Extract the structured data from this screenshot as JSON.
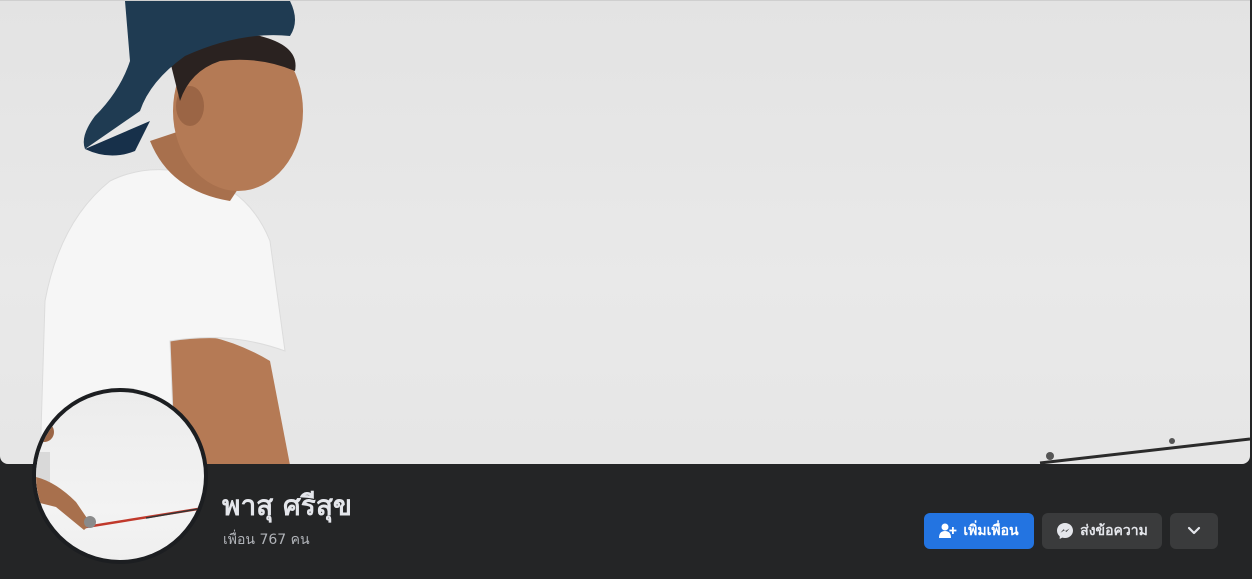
{
  "profile": {
    "name": "พาสุ ศรีสุข",
    "friends_text": "เพื่อน 767 คน"
  },
  "actions": {
    "add_friend_label": "เพิ่มเพื่อน",
    "message_label": "ส่งข้อความ",
    "more_icon": "chevron-down-icon"
  },
  "colors": {
    "background": "#242526",
    "primary_button": "#2374e1",
    "secondary_button": "#3a3b3c",
    "text_primary": "#e4e6eb",
    "text_secondary": "#b0b3b8"
  }
}
